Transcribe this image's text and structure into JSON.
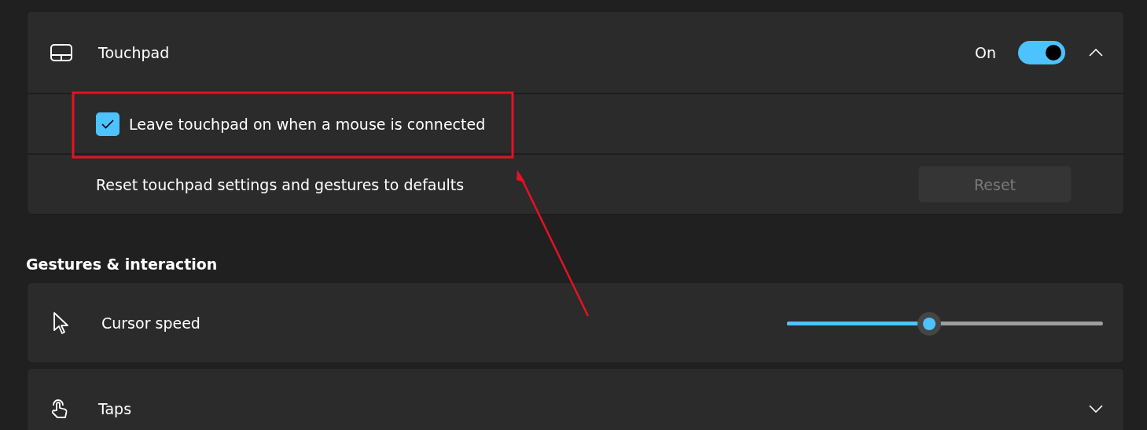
{
  "touchpad": {
    "title": "Touchpad",
    "state_label": "On",
    "on": true,
    "expanded": true,
    "options": [
      {
        "kind": "checkbox",
        "label": "Leave touchpad on when a mouse is connected",
        "checked": true,
        "highlighted": true
      },
      {
        "kind": "button",
        "label": "Reset touchpad settings and gestures to defaults",
        "button": "Reset",
        "disabled": true
      }
    ]
  },
  "section": {
    "title": "Gestures & interaction",
    "items": [
      {
        "kind": "slider",
        "label": "Cursor speed",
        "level": 0.45
      },
      {
        "kind": "expander",
        "label": "Taps",
        "expanded": false
      }
    ]
  }
}
